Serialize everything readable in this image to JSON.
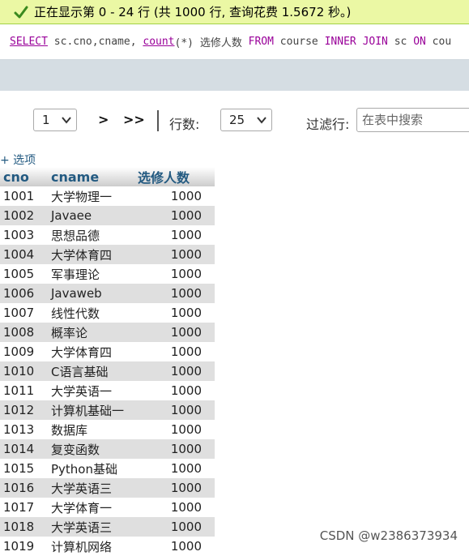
{
  "status": {
    "message": "正在显示第 0 - 24 行 (共 1000 行, 查询花费 1.5672 秒。)",
    "success_color": "#ebf8a4"
  },
  "sql": {
    "select": "SELECT",
    "part1": " sc.cno,cname, ",
    "count_fn": "count",
    "part2": "(*) 选修人数 ",
    "from": "FROM",
    "part3": " course ",
    "inner": "INNER",
    "part4": " ",
    "join": "JOIN",
    "part5": " sc ",
    "on": "ON",
    "part6": " cou"
  },
  "navigation": {
    "page_value": "1",
    "next_label": ">",
    "last_label": ">>",
    "rows_label": "行数:",
    "rows_value": "25",
    "filter_label": "过滤行:",
    "filter_placeholder": "在表中搜索"
  },
  "options_link": "+ 选项",
  "table": {
    "columns": [
      "cno",
      "cname",
      "选修人数"
    ],
    "rows": [
      [
        "1001",
        "大学物理一",
        "1000"
      ],
      [
        "1002",
        "Javaee",
        "1000"
      ],
      [
        "1003",
        "思想品德",
        "1000"
      ],
      [
        "1004",
        "大学体育四",
        "1000"
      ],
      [
        "1005",
        "军事理论",
        "1000"
      ],
      [
        "1006",
        "Javaweb",
        "1000"
      ],
      [
        "1007",
        "线性代数",
        "1000"
      ],
      [
        "1008",
        "概率论",
        "1000"
      ],
      [
        "1009",
        "大学体育四",
        "1000"
      ],
      [
        "1010",
        "C语言基础",
        "1000"
      ],
      [
        "1011",
        "大学英语一",
        "1000"
      ],
      [
        "1012",
        "计算机基础一",
        "1000"
      ],
      [
        "1013",
        "数据库",
        "1000"
      ],
      [
        "1014",
        "复变函数",
        "1000"
      ],
      [
        "1015",
        "Python基础",
        "1000"
      ],
      [
        "1016",
        "大学英语三",
        "1000"
      ],
      [
        "1017",
        "大学体育一",
        "1000"
      ],
      [
        "1018",
        "大学英语三",
        "1000"
      ],
      [
        "1019",
        "计算机网络",
        "1000"
      ]
    ]
  },
  "watermark": "CSDN @w2386373934",
  "icons": {
    "status": "check-icon",
    "select_arrow": "chevron-down-icon"
  }
}
